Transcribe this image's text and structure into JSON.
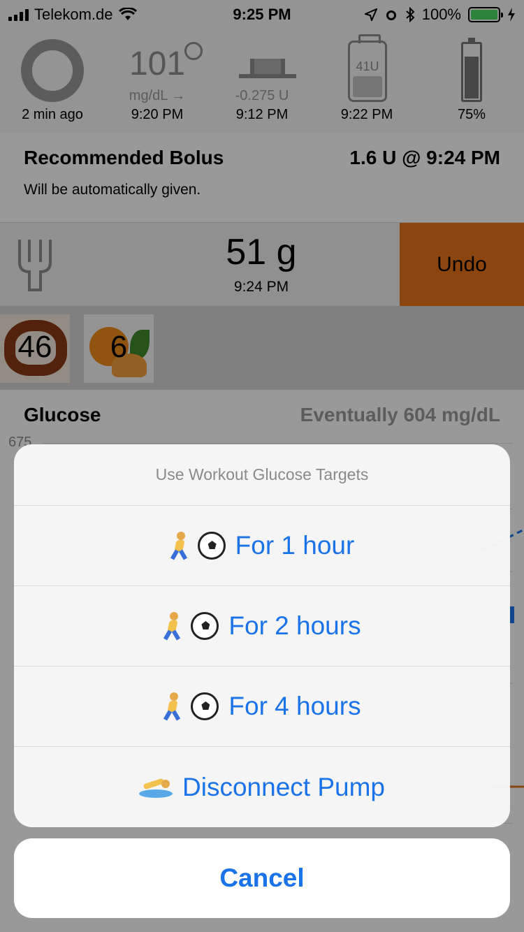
{
  "status_bar": {
    "carrier": "Telekom.de",
    "time": "9:25 PM",
    "battery_percent": "100%",
    "battery_level": 1.0
  },
  "hud": {
    "loop_caption": "2 min ago",
    "glucose_value": "101",
    "glucose_unit": "mg/dL →",
    "glucose_time": "9:20 PM",
    "basal_value": "-0.275 U",
    "basal_time": "9:12 PM",
    "reservoir_label": "41U",
    "reservoir_time": "9:22 PM",
    "pump_battery": "75%",
    "pump_battery_level": 0.75
  },
  "bolus": {
    "title": "Recommended Bolus",
    "amount": "1.6 U @ 9:24 PM",
    "note": "Will be automatically given."
  },
  "carbs": {
    "amount": "51 g",
    "time": "9:24 PM",
    "undo_label": "Undo",
    "undo_color": "#e8731a"
  },
  "foods": [
    {
      "icon": "pretzel-icon",
      "count": "46"
    },
    {
      "icon": "orange-icon",
      "count": "6"
    }
  ],
  "glucose": {
    "title": "Glucose",
    "eventual": "Eventually 604 mg/dL",
    "axis_top": "675"
  },
  "action_sheet": {
    "title": "Use Workout Glucose Targets",
    "items": [
      {
        "label": "For 1 hour",
        "icons": [
          "runner-icon",
          "soccer-ball-icon"
        ]
      },
      {
        "label": "For 2 hours",
        "icons": [
          "runner-icon",
          "soccer-ball-icon"
        ]
      },
      {
        "label": "For 4 hours",
        "icons": [
          "runner-icon",
          "soccer-ball-icon"
        ]
      },
      {
        "label": "Disconnect Pump",
        "icons": [
          "swimmer-icon"
        ]
      }
    ],
    "cancel_label": "Cancel",
    "accent_color": "#1a73e8"
  }
}
